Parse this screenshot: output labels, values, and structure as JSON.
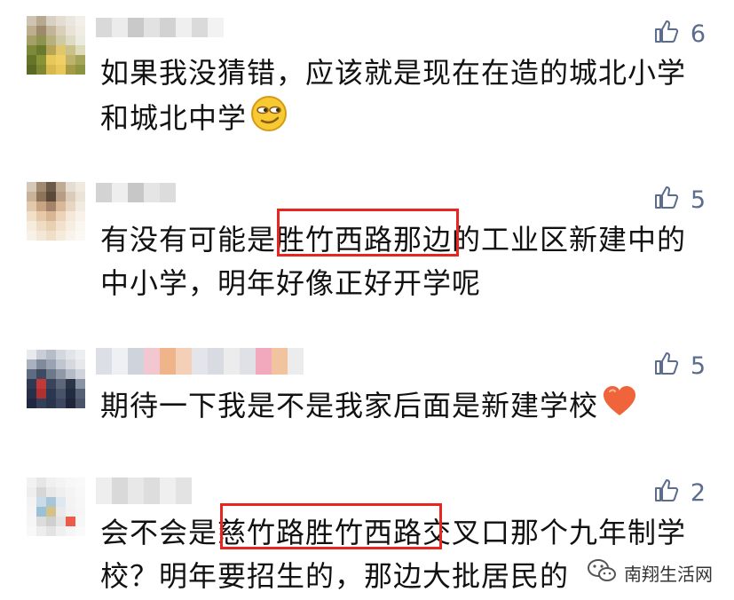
{
  "comments": [
    {
      "likes": "6",
      "lines": [
        "如果我没猜错，应该就是现在在造的城北小学",
        "和城北中学"
      ]
    },
    {
      "likes": "5",
      "lines": [
        "有没有可能是胜竹西路那边的工业区新建中的",
        "中小学，明年好像正好开学呢"
      ]
    },
    {
      "likes": "5",
      "lines": [
        "期待一下我是不是我家后面是新建学校"
      ]
    },
    {
      "likes": "2",
      "lines": [
        "会不会是慈竹路胜竹西路交叉口那个九年制学",
        "校？明年要招生的，那边大批居民的"
      ]
    }
  ],
  "watermark": "南翔生活网",
  "icons": {
    "like": "thumbs-up-icon",
    "emoji_grin": "smirk-emoji-icon",
    "emoji_heart": "heart-emoji-icon",
    "wechat": "wechat-icon"
  },
  "colors": {
    "like_count": "#5b6c8c",
    "highlight_box": "#e8261f",
    "text": "#111111"
  }
}
